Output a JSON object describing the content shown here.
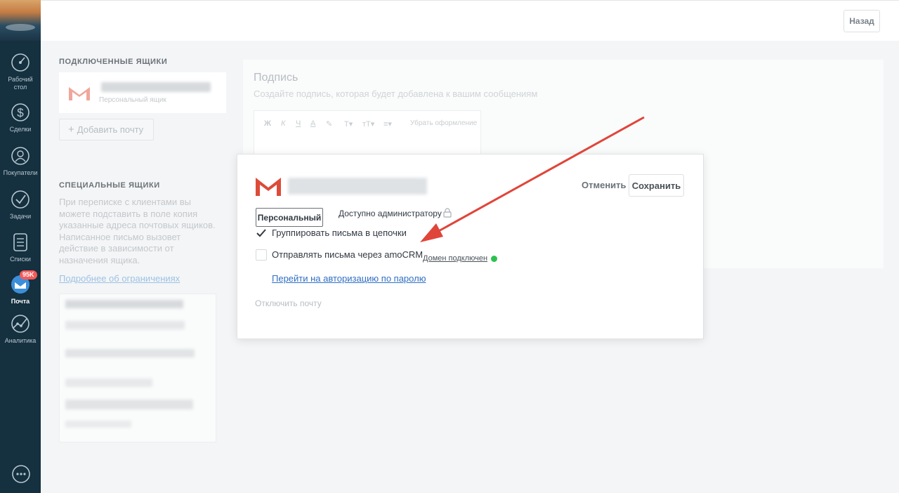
{
  "sidebar": {
    "items": [
      {
        "label": "Рабочий стол",
        "icon": "dashboard-icon"
      },
      {
        "label": "Сделки",
        "icon": "dollar-icon"
      },
      {
        "label": "Покупатели",
        "icon": "customers-icon"
      },
      {
        "label": "Задачи",
        "icon": "tasks-icon"
      },
      {
        "label": "Списки",
        "icon": "lists-icon"
      },
      {
        "label": "Почта",
        "icon": "mail-icon",
        "badge": "95K",
        "active": true
      },
      {
        "label": "Аналитика",
        "icon": "analytics-icon"
      }
    ],
    "chat_icon": "chat-icon"
  },
  "topbar": {
    "back_label": "Назад"
  },
  "connected": {
    "title": "ПОДКЛЮЧЕННЫЕ ЯЩИКИ",
    "mailbox_type": "Персональный ящик",
    "add_label": "Добавить почту"
  },
  "special": {
    "title": "СПЕЦИАЛЬНЫЕ ЯЩИКИ",
    "description": "При переписке с клиентами вы можете подставить в поле копия указанные адреса почтовых ящиков. Написанное письмо вызовет действие в зависимости от назначения ящика.",
    "link": "Подробнее об ограничениях"
  },
  "signature": {
    "title": "Подпись",
    "subtitle": "Создайте подпись, которая будет добавлена к вашим сообщениям",
    "toolbar": [
      "Ж",
      "К",
      "Ч",
      "А",
      "",
      "T▾",
      "ᴛT▾",
      "≡▾"
    ],
    "clear_label": "Убрать оформление"
  },
  "modal": {
    "cancel_label": "Отменить",
    "save_label": "Сохранить",
    "type_label": "Персональный",
    "access_label": "Доступно администратору",
    "group_label": "Группировать письма в цепочки",
    "group_checked": true,
    "send_label": "Отправлять письма через amoCRM",
    "send_checked": false,
    "domain_label": "Домен подключен",
    "domain_status_color": "#2cc14d",
    "auth_link": "Перейти на авторизацию по паролю",
    "disconnect_label": "Отключить почту"
  },
  "colors": {
    "sidebar": "#15303f",
    "gmail_red": "#dd4b39",
    "arrow": "#e0453a",
    "link": "#2f6fc3"
  }
}
